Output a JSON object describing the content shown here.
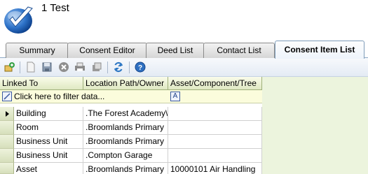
{
  "header": {
    "title": "1 Test"
  },
  "tabs": [
    {
      "label": "Summary",
      "active": false
    },
    {
      "label": "Consent Editor",
      "active": false
    },
    {
      "label": "Deed List",
      "active": false
    },
    {
      "label": "Contact List",
      "active": false
    },
    {
      "label": "Consent Item List",
      "active": true
    }
  ],
  "toolbar": {
    "buttons": [
      "add-link-icon",
      "new-icon",
      "save-icon",
      "delete-icon",
      "print-icon",
      "export-icon",
      "refresh-icon",
      "help-icon"
    ]
  },
  "grid": {
    "columns": [
      "Linked To",
      "Location Path/Owner",
      "Asset/Component/Tree"
    ],
    "filter_placeholder": "Click here to filter data...",
    "filter_operator": "A",
    "rows": [
      {
        "linked_to": "Building",
        "location": ".The Forest Academy\\",
        "asset": "",
        "current": true
      },
      {
        "linked_to": "Room",
        "location": ".Broomlands Primary",
        "asset": "",
        "current": false
      },
      {
        "linked_to": "Business Unit",
        "location": ".Broomlands Primary",
        "asset": "",
        "current": false
      },
      {
        "linked_to": "Business Unit",
        "location": ".Compton Garage",
        "asset": "",
        "current": false
      },
      {
        "linked_to": "Asset",
        "location": ".Broomlands Primary",
        "asset": "10000101 Air Handling",
        "current": false
      }
    ]
  },
  "colors": {
    "grid_header": "#dfe8c2",
    "filter_row": "#fbfcdc",
    "side_pane": "#ecf4dd",
    "active_tab": "#eef4fb"
  }
}
